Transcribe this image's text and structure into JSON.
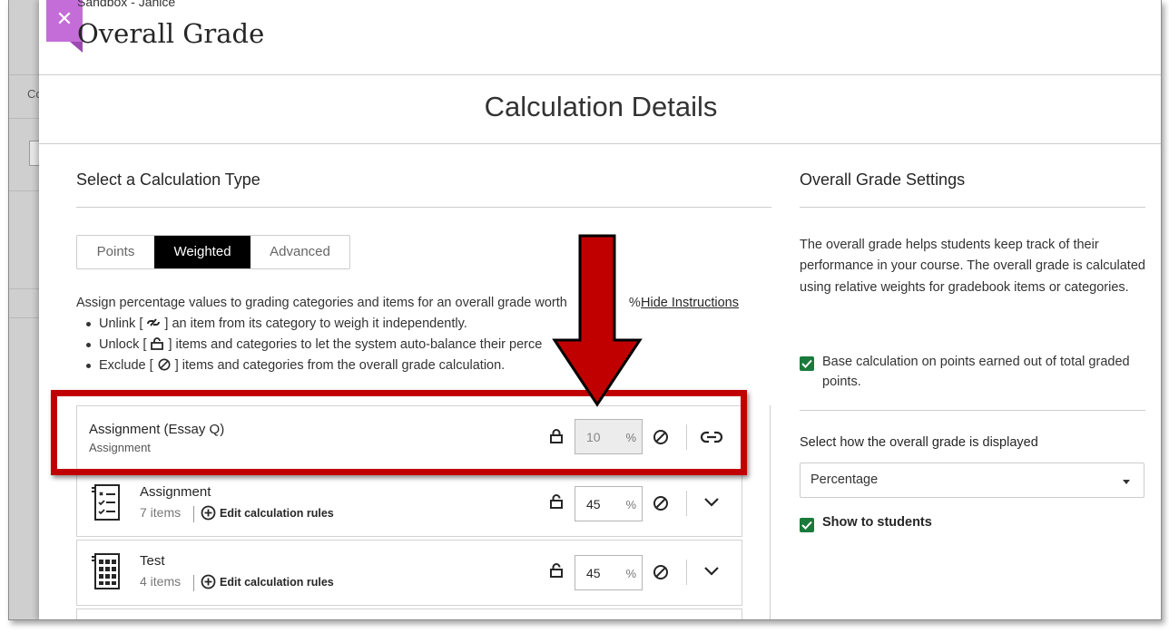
{
  "header": {
    "breadcrumb": "Sandbox - Janice",
    "title": "Overall Grade",
    "close_icon": "close-icon"
  },
  "background": {
    "partial_text": "Co"
  },
  "section_title": "Calculation Details",
  "calc": {
    "heading": "Select a Calculation Type",
    "tabs": [
      {
        "label": "Points",
        "selected": false
      },
      {
        "label": "Weighted",
        "selected": true
      },
      {
        "label": "Advanced",
        "selected": false
      }
    ],
    "instructions": {
      "intro_a": "Assign percentage values to grading categories and items for an overall grade worth",
      "intro_b": "%.",
      "hide_link": "Hide Instructions",
      "bullet1_a": "Unlink [",
      "bullet1_b": "] an item from its category to weigh it independently.",
      "bullet2_a": "Unlock [",
      "bullet2_b": "] items and categories to let the system auto-balance their perce",
      "bullet3_a": "Exclude [",
      "bullet3_b": "] items and categories from the overall grade calculation."
    },
    "rows": [
      {
        "name": "Assignment (Essay Q)",
        "sub": "Assignment",
        "value": "10",
        "unit": "%",
        "locked": true
      },
      {
        "name": "Assignment",
        "count": "7 items",
        "edit": "Edit calculation rules",
        "value": "45",
        "unit": "%",
        "locked": false
      },
      {
        "name": "Test",
        "count": "4 items",
        "edit": "Edit calculation rules",
        "value": "45",
        "unit": "%",
        "locked": false
      }
    ]
  },
  "settings": {
    "heading": "Overall Grade Settings",
    "description": "The overall grade helps students keep track of their performance in your course. The overall grade is calculated using relative weights for gradebook items or categories.",
    "base_calc_label": "Base calculation on points earned out of total graded points.",
    "base_calc_checked": true,
    "display_label": "Select how the overall grade is displayed",
    "display_value": "Percentage",
    "show_label": "Show to students",
    "show_checked": true
  },
  "colors": {
    "accent_close": "#c46cd8",
    "highlight": "#c00000",
    "checkbox": "#1a7a3c",
    "selected_tab": "#000000"
  }
}
